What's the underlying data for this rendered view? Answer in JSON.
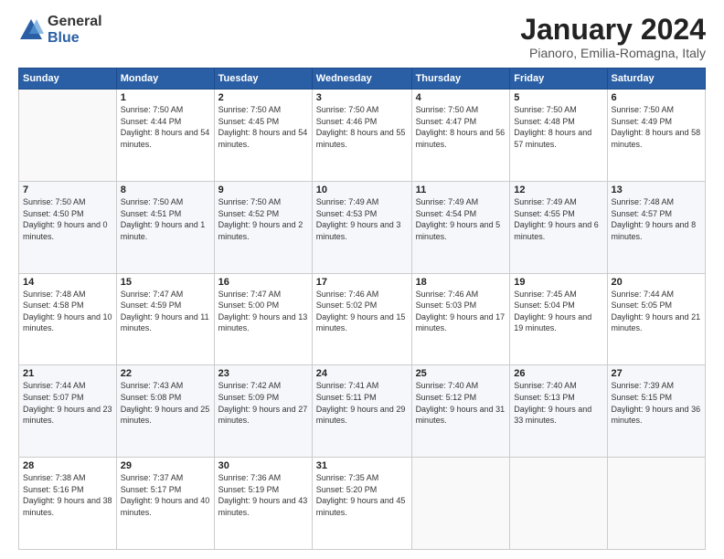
{
  "logo": {
    "general": "General",
    "blue": "Blue"
  },
  "header": {
    "title": "January 2024",
    "subtitle": "Pianoro, Emilia-Romagna, Italy"
  },
  "weekdays": [
    "Sunday",
    "Monday",
    "Tuesday",
    "Wednesday",
    "Thursday",
    "Friday",
    "Saturday"
  ],
  "weeks": [
    [
      {
        "day": "",
        "sunrise": "",
        "sunset": "",
        "daylight": ""
      },
      {
        "day": "1",
        "sunrise": "Sunrise: 7:50 AM",
        "sunset": "Sunset: 4:44 PM",
        "daylight": "Daylight: 8 hours and 54 minutes."
      },
      {
        "day": "2",
        "sunrise": "Sunrise: 7:50 AM",
        "sunset": "Sunset: 4:45 PM",
        "daylight": "Daylight: 8 hours and 54 minutes."
      },
      {
        "day": "3",
        "sunrise": "Sunrise: 7:50 AM",
        "sunset": "Sunset: 4:46 PM",
        "daylight": "Daylight: 8 hours and 55 minutes."
      },
      {
        "day": "4",
        "sunrise": "Sunrise: 7:50 AM",
        "sunset": "Sunset: 4:47 PM",
        "daylight": "Daylight: 8 hours and 56 minutes."
      },
      {
        "day": "5",
        "sunrise": "Sunrise: 7:50 AM",
        "sunset": "Sunset: 4:48 PM",
        "daylight": "Daylight: 8 hours and 57 minutes."
      },
      {
        "day": "6",
        "sunrise": "Sunrise: 7:50 AM",
        "sunset": "Sunset: 4:49 PM",
        "daylight": "Daylight: 8 hours and 58 minutes."
      }
    ],
    [
      {
        "day": "7",
        "sunrise": "Sunrise: 7:50 AM",
        "sunset": "Sunset: 4:50 PM",
        "daylight": "Daylight: 9 hours and 0 minutes."
      },
      {
        "day": "8",
        "sunrise": "Sunrise: 7:50 AM",
        "sunset": "Sunset: 4:51 PM",
        "daylight": "Daylight: 9 hours and 1 minute."
      },
      {
        "day": "9",
        "sunrise": "Sunrise: 7:50 AM",
        "sunset": "Sunset: 4:52 PM",
        "daylight": "Daylight: 9 hours and 2 minutes."
      },
      {
        "day": "10",
        "sunrise": "Sunrise: 7:49 AM",
        "sunset": "Sunset: 4:53 PM",
        "daylight": "Daylight: 9 hours and 3 minutes."
      },
      {
        "day": "11",
        "sunrise": "Sunrise: 7:49 AM",
        "sunset": "Sunset: 4:54 PM",
        "daylight": "Daylight: 9 hours and 5 minutes."
      },
      {
        "day": "12",
        "sunrise": "Sunrise: 7:49 AM",
        "sunset": "Sunset: 4:55 PM",
        "daylight": "Daylight: 9 hours and 6 minutes."
      },
      {
        "day": "13",
        "sunrise": "Sunrise: 7:48 AM",
        "sunset": "Sunset: 4:57 PM",
        "daylight": "Daylight: 9 hours and 8 minutes."
      }
    ],
    [
      {
        "day": "14",
        "sunrise": "Sunrise: 7:48 AM",
        "sunset": "Sunset: 4:58 PM",
        "daylight": "Daylight: 9 hours and 10 minutes."
      },
      {
        "day": "15",
        "sunrise": "Sunrise: 7:47 AM",
        "sunset": "Sunset: 4:59 PM",
        "daylight": "Daylight: 9 hours and 11 minutes."
      },
      {
        "day": "16",
        "sunrise": "Sunrise: 7:47 AM",
        "sunset": "Sunset: 5:00 PM",
        "daylight": "Daylight: 9 hours and 13 minutes."
      },
      {
        "day": "17",
        "sunrise": "Sunrise: 7:46 AM",
        "sunset": "Sunset: 5:02 PM",
        "daylight": "Daylight: 9 hours and 15 minutes."
      },
      {
        "day": "18",
        "sunrise": "Sunrise: 7:46 AM",
        "sunset": "Sunset: 5:03 PM",
        "daylight": "Daylight: 9 hours and 17 minutes."
      },
      {
        "day": "19",
        "sunrise": "Sunrise: 7:45 AM",
        "sunset": "Sunset: 5:04 PM",
        "daylight": "Daylight: 9 hours and 19 minutes."
      },
      {
        "day": "20",
        "sunrise": "Sunrise: 7:44 AM",
        "sunset": "Sunset: 5:05 PM",
        "daylight": "Daylight: 9 hours and 21 minutes."
      }
    ],
    [
      {
        "day": "21",
        "sunrise": "Sunrise: 7:44 AM",
        "sunset": "Sunset: 5:07 PM",
        "daylight": "Daylight: 9 hours and 23 minutes."
      },
      {
        "day": "22",
        "sunrise": "Sunrise: 7:43 AM",
        "sunset": "Sunset: 5:08 PM",
        "daylight": "Daylight: 9 hours and 25 minutes."
      },
      {
        "day": "23",
        "sunrise": "Sunrise: 7:42 AM",
        "sunset": "Sunset: 5:09 PM",
        "daylight": "Daylight: 9 hours and 27 minutes."
      },
      {
        "day": "24",
        "sunrise": "Sunrise: 7:41 AM",
        "sunset": "Sunset: 5:11 PM",
        "daylight": "Daylight: 9 hours and 29 minutes."
      },
      {
        "day": "25",
        "sunrise": "Sunrise: 7:40 AM",
        "sunset": "Sunset: 5:12 PM",
        "daylight": "Daylight: 9 hours and 31 minutes."
      },
      {
        "day": "26",
        "sunrise": "Sunrise: 7:40 AM",
        "sunset": "Sunset: 5:13 PM",
        "daylight": "Daylight: 9 hours and 33 minutes."
      },
      {
        "day": "27",
        "sunrise": "Sunrise: 7:39 AM",
        "sunset": "Sunset: 5:15 PM",
        "daylight": "Daylight: 9 hours and 36 minutes."
      }
    ],
    [
      {
        "day": "28",
        "sunrise": "Sunrise: 7:38 AM",
        "sunset": "Sunset: 5:16 PM",
        "daylight": "Daylight: 9 hours and 38 minutes."
      },
      {
        "day": "29",
        "sunrise": "Sunrise: 7:37 AM",
        "sunset": "Sunset: 5:17 PM",
        "daylight": "Daylight: 9 hours and 40 minutes."
      },
      {
        "day": "30",
        "sunrise": "Sunrise: 7:36 AM",
        "sunset": "Sunset: 5:19 PM",
        "daylight": "Daylight: 9 hours and 43 minutes."
      },
      {
        "day": "31",
        "sunrise": "Sunrise: 7:35 AM",
        "sunset": "Sunset: 5:20 PM",
        "daylight": "Daylight: 9 hours and 45 minutes."
      },
      {
        "day": "",
        "sunrise": "",
        "sunset": "",
        "daylight": ""
      },
      {
        "day": "",
        "sunrise": "",
        "sunset": "",
        "daylight": ""
      },
      {
        "day": "",
        "sunrise": "",
        "sunset": "",
        "daylight": ""
      }
    ]
  ]
}
